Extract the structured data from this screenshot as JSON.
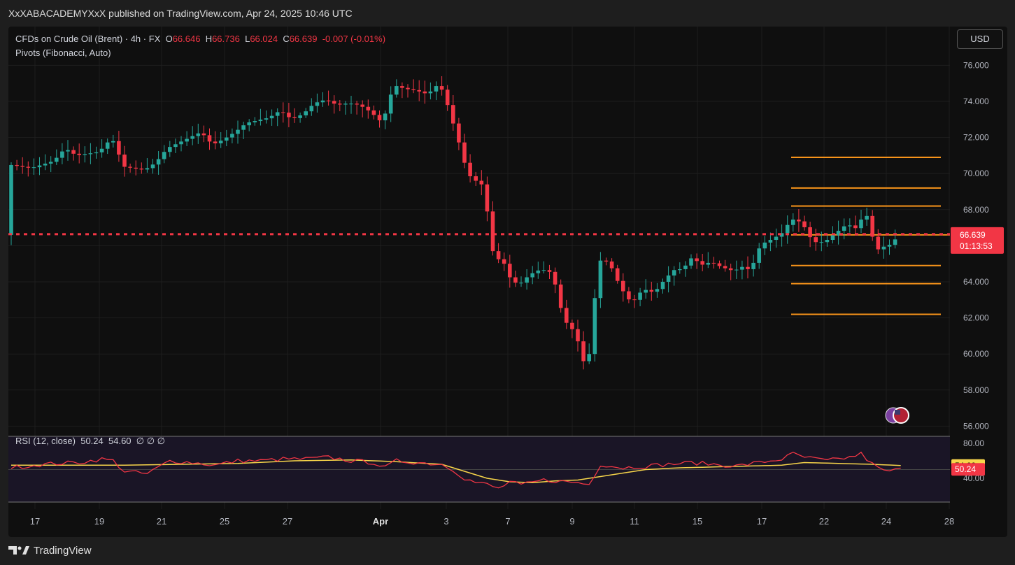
{
  "publisher_line": "XxXABACADEMYXxX published on TradingView.com, Apr 24, 2025 10:46 UTC",
  "brand": "TradingView",
  "currency_button": "USD",
  "legend": {
    "symbol": "CFDs on Crude Oil (Brent) · 4h · FX",
    "open_label": "O",
    "open": "66.646",
    "high_label": "H",
    "high": "66.736",
    "low_label": "L",
    "low": "66.024",
    "close_label": "C",
    "close": "66.639",
    "change": "-0.007 (-0.01%)",
    "indicator": "Pivots (Fibonacci, Auto)"
  },
  "rsi_legend": {
    "name": "RSI (12, close)",
    "rsi_value": "50.24",
    "ma_value": "54.60",
    "extras": "∅ ∅ ∅"
  },
  "colors": {
    "up": "#26a69a",
    "down": "#f23645",
    "pivot": "#f7931a",
    "rsi_line": "#f23645",
    "rsi_ma": "#f7d54a",
    "grid": "#1e1e1e"
  },
  "chart_data": {
    "type": "candlestick",
    "ylim": [
      56,
      77
    ],
    "y_ticks": [
      "76.000",
      "74.000",
      "72.000",
      "70.000",
      "68.000",
      "66.000",
      "64.000",
      "62.000",
      "60.000",
      "58.000",
      "56.000"
    ],
    "x_ticks": [
      "17",
      "19",
      "21",
      "25",
      "27",
      "Apr",
      "3",
      "7",
      "9",
      "11",
      "15",
      "17",
      "22",
      "24",
      "28"
    ],
    "last_price": 66.639,
    "last_price_label": "66.639",
    "countdown": "01:13:53",
    "pivot_levels": [
      70.9,
      69.2,
      68.2,
      66.6,
      64.9,
      63.9,
      62.2
    ],
    "price_path": [
      [
        0,
        70.5
      ],
      [
        4,
        70.3
      ],
      [
        8,
        70.7
      ],
      [
        10,
        71.4
      ],
      [
        12,
        71.0
      ],
      [
        16,
        71.2
      ],
      [
        18,
        71.9
      ],
      [
        19,
        71.7
      ],
      [
        20,
        70.4
      ],
      [
        24,
        70.2
      ],
      [
        26,
        70.6
      ],
      [
        28,
        71.4
      ],
      [
        32,
        72.0
      ],
      [
        34,
        72.3
      ],
      [
        36,
        71.6
      ],
      [
        38,
        71.9
      ],
      [
        40,
        72.3
      ],
      [
        42,
        72.8
      ],
      [
        46,
        73.1
      ],
      [
        48,
        73.5
      ],
      [
        50,
        73.0
      ],
      [
        52,
        73.3
      ],
      [
        54,
        73.9
      ],
      [
        56,
        74.1
      ],
      [
        58,
        73.8
      ],
      [
        60,
        73.9
      ],
      [
        62,
        73.8
      ],
      [
        64,
        73.4
      ],
      [
        66,
        72.8
      ],
      [
        68,
        74.9
      ],
      [
        70,
        74.7
      ],
      [
        72,
        74.6
      ],
      [
        74,
        74.4
      ],
      [
        76,
        75.0
      ],
      [
        77,
        74.3
      ],
      [
        78,
        73.3
      ],
      [
        80,
        71.2
      ],
      [
        81,
        70.0
      ],
      [
        82,
        69.7
      ],
      [
        84,
        69.3
      ],
      [
        85,
        66.5
      ],
      [
        86,
        64.9
      ],
      [
        87,
        65.6
      ],
      [
        88,
        64.4
      ],
      [
        90,
        63.8
      ],
      [
        92,
        64.4
      ],
      [
        94,
        64.7
      ],
      [
        96,
        64.5
      ],
      [
        97,
        63.2
      ],
      [
        98,
        61.9
      ],
      [
        100,
        61.2
      ],
      [
        101,
        60.2
      ],
      [
        102,
        59.0
      ],
      [
        103,
        61.0
      ],
      [
        104,
        65.2
      ],
      [
        106,
        65.1
      ],
      [
        108,
        63.7
      ],
      [
        110,
        62.8
      ],
      [
        112,
        63.6
      ],
      [
        114,
        63.4
      ],
      [
        116,
        64.2
      ],
      [
        118,
        64.8
      ],
      [
        119,
        64.6
      ],
      [
        120,
        65.2
      ],
      [
        121,
        65.4
      ],
      [
        122,
        64.9
      ],
      [
        124,
        65.1
      ],
      [
        126,
        64.8
      ],
      [
        128,
        64.6
      ],
      [
        130,
        64.9
      ],
      [
        131,
        64.5
      ],
      [
        132,
        65.6
      ],
      [
        133,
        66.1
      ],
      [
        135,
        66.4
      ],
      [
        137,
        66.8
      ],
      [
        138,
        67.5
      ],
      [
        140,
        67.3
      ],
      [
        142,
        66.2
      ],
      [
        144,
        66.2
      ],
      [
        146,
        66.7
      ],
      [
        148,
        67.2
      ],
      [
        150,
        66.9
      ],
      [
        151,
        68.0
      ],
      [
        152,
        67.3
      ],
      [
        153,
        65.7
      ],
      [
        154,
        65.9
      ],
      [
        156,
        66.1
      ],
      [
        157,
        66.6
      ]
    ],
    "rsi": {
      "ylim": [
        20,
        90
      ],
      "ticks": [
        "80.00",
        "40.00"
      ],
      "rsi_value": 50.24,
      "ma_value": 54.6,
      "rsi_path": [
        [
          0,
          52
        ],
        [
          4,
          55
        ],
        [
          8,
          57
        ],
        [
          12,
          58
        ],
        [
          16,
          62
        ],
        [
          18,
          60
        ],
        [
          20,
          48
        ],
        [
          24,
          45
        ],
        [
          28,
          60
        ],
        [
          32,
          58
        ],
        [
          36,
          55
        ],
        [
          40,
          60
        ],
        [
          44,
          60
        ],
        [
          48,
          62
        ],
        [
          52,
          62
        ],
        [
          56,
          64
        ],
        [
          60,
          60
        ],
        [
          64,
          58
        ],
        [
          66,
          52
        ],
        [
          68,
          60
        ],
        [
          72,
          58
        ],
        [
          76,
          56
        ],
        [
          78,
          50
        ],
        [
          80,
          40
        ],
        [
          82,
          35
        ],
        [
          84,
          33
        ],
        [
          86,
          28
        ],
        [
          88,
          36
        ],
        [
          90,
          32
        ],
        [
          94,
          38
        ],
        [
          98,
          36
        ],
        [
          100,
          35
        ],
        [
          102,
          33
        ],
        [
          104,
          56
        ],
        [
          108,
          52
        ],
        [
          112,
          54
        ],
        [
          116,
          56
        ],
        [
          120,
          58
        ],
        [
          124,
          56
        ],
        [
          128,
          54
        ],
        [
          132,
          58
        ],
        [
          136,
          62
        ],
        [
          138,
          68
        ],
        [
          140,
          64
        ],
        [
          144,
          60
        ],
        [
          148,
          64
        ],
        [
          150,
          68
        ],
        [
          152,
          56
        ],
        [
          154,
          48
        ],
        [
          157,
          50
        ]
      ],
      "ma_path": [
        [
          0,
          55
        ],
        [
          10,
          55
        ],
        [
          20,
          55
        ],
        [
          30,
          56
        ],
        [
          40,
          57
        ],
        [
          50,
          60
        ],
        [
          60,
          61
        ],
        [
          68,
          59
        ],
        [
          76,
          56
        ],
        [
          80,
          48
        ],
        [
          84,
          40
        ],
        [
          88,
          36
        ],
        [
          92,
          35
        ],
        [
          96,
          37
        ],
        [
          100,
          38
        ],
        [
          104,
          42
        ],
        [
          108,
          46
        ],
        [
          112,
          50
        ],
        [
          118,
          52
        ],
        [
          124,
          53
        ],
        [
          130,
          54
        ],
        [
          136,
          55
        ],
        [
          140,
          58
        ],
        [
          146,
          57
        ],
        [
          152,
          56
        ],
        [
          157,
          54.6
        ]
      ]
    }
  }
}
